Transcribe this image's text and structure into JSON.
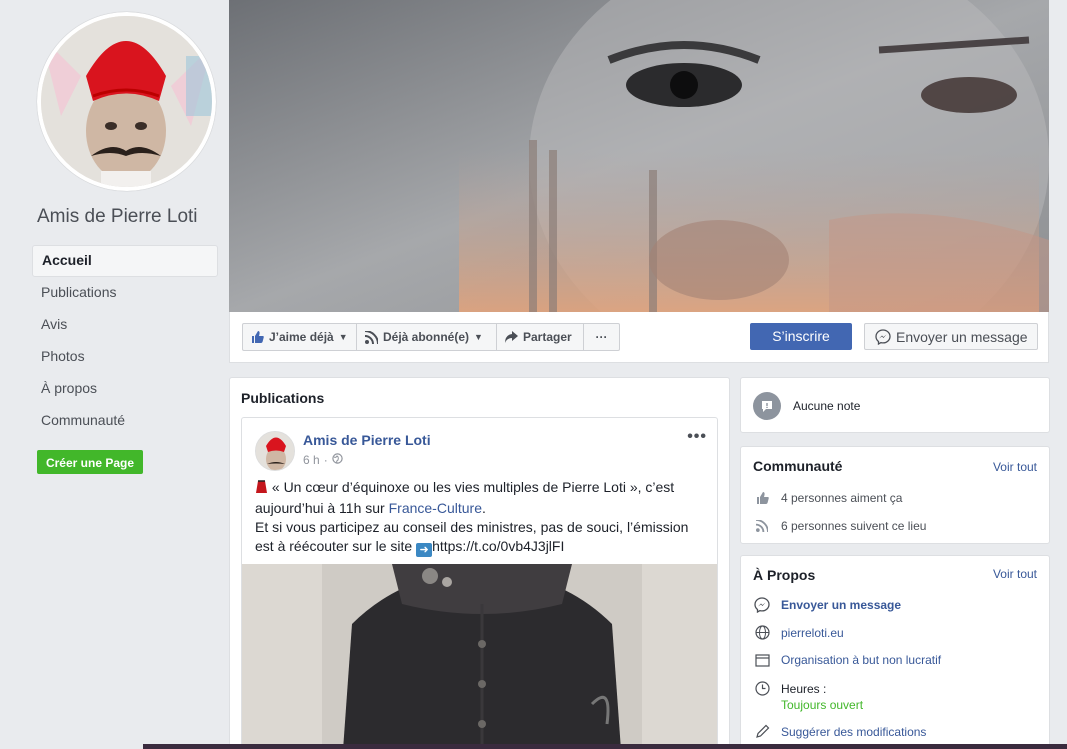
{
  "page": {
    "name": "Amis de Pierre Loti"
  },
  "sidebar": {
    "items": [
      {
        "label": "Accueil",
        "active": true
      },
      {
        "label": "Publications"
      },
      {
        "label": "Avis"
      },
      {
        "label": "Photos"
      },
      {
        "label": "À propos"
      },
      {
        "label": "Communauté"
      }
    ],
    "create_page": "Créer une Page"
  },
  "actions": {
    "like": "J’aime déjà",
    "follow": "Déjà abonné(e)",
    "share": "Partager",
    "more": "···",
    "signup": "S’inscrire",
    "message": "Envoyer un message"
  },
  "posts": {
    "title": "Publications",
    "post": {
      "author": "Amis de Pierre Loti",
      "time": "6 h",
      "more": "•••",
      "text_part1": "« Un cœur d’équinoxe ou les vies multiples de Pierre Loti », c’est aujourd’hui à 11h sur ",
      "text_link": "France-Culture",
      "text_part2": ".",
      "text_line2": "Et si vous participez au conseil des ministres, pas de souci, l’émission est à réécouter sur le site ",
      "text_url": "https://t.co/0vb4J3jlFI"
    }
  },
  "notes": {
    "label": "Aucune note"
  },
  "community": {
    "title": "Communauté",
    "see_all": "Voir tout",
    "likes": "4 personnes aiment ça",
    "follows": "6 personnes suivent ce lieu"
  },
  "about": {
    "title": "À Propos",
    "see_all": "Voir tout",
    "message": "Envoyer un message",
    "website": "pierreloti.eu",
    "category": "Organisation à but non lucratif",
    "hours_label": "Heures :",
    "hours_value": "Toujours ouvert",
    "suggest": "Suggérer des modifications"
  },
  "colors": {
    "facebook_blue": "#4267b2",
    "link": "#385898",
    "green": "#42b72a",
    "background": "#e9ebee"
  }
}
